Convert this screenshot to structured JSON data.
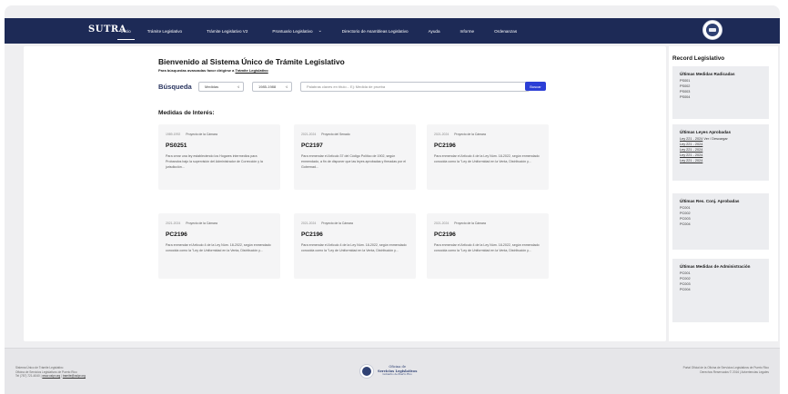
{
  "nav": {
    "logo": "SUTRA",
    "items": [
      "Inicio",
      "Trámite Legislativo",
      "Trámite Legislativo V2",
      "Prontuario Legislativo",
      "Directorio de Asambleas Legislativo",
      "Ayuda",
      "Informe",
      "Ordenanzas"
    ],
    "dropdown_glyph": "⌄"
  },
  "main": {
    "title": "Bienvenido al Sistema Único de Trámite Legislativo",
    "subtitle_prefix": "Para búsquedas avanzadas favor dirigirse a ",
    "subtitle_link": "Trámite Legislativo",
    "search": {
      "label": "Búsqueda",
      "type_value": "Medidas",
      "period_value": "1985-1988",
      "placeholder": "Palabras claves en título... Ej: Medida de prueba",
      "button": "Buscar"
    },
    "interest_title": "Medidas de Interés:",
    "cards": [
      {
        "period": "1989-1992",
        "origin": "Proyecto de la Cámara",
        "id": "PS0251",
        "desc": "Para crear una ley estableciendo los Hogares intermedios para Probandos bajo la supervisión del Administrador de Corrección y la jurisdicción..."
      },
      {
        "period": "2021-2024",
        "origin": "Proyecto del Senado",
        "id": "PC2197",
        "desc": "Para enmendar el Artículo 37 del Código Político de 1902, según enmendado, a fin de disponer que las leyes aprobadas y firmadas por el Gobernad..."
      },
      {
        "period": "2021-2024",
        "origin": "Proyecto de la Cámara",
        "id": "PC2196",
        "desc": "Para enmendar el Artículo 4 de la Ley Núm. 18-2022, según enmendado conocida como la \"Ley de Uniformidad en la Venta, Distribución y..."
      },
      {
        "period": "2021-2024",
        "origin": "Proyecto de la Cámara",
        "id": "PC2196",
        "desc": "Para enmendar el Artículo 4 de la Ley Núm. 18-2022, según enmendado conocida como la \"Ley de Uniformidad en la Venta, Distribución y..."
      },
      {
        "period": "2021-2024",
        "origin": "Proyecto de la Cámara",
        "id": "PC2196",
        "desc": "Para enmendar el Artículo 4 de la Ley Núm. 18-2022, según enmendado conocida como la \"Ley de Uniformidad en la Venta, Distribución y..."
      },
      {
        "period": "2021-2024",
        "origin": "Proyecto de la Cámara",
        "id": "PC2196",
        "desc": "Para enmendar el Artículo 4 de la Ley Núm. 18-2022, según enmendado conocida como la \"Ley de Uniformidad en la Venta, Distribución y..."
      }
    ]
  },
  "side": {
    "title": "Record Legislativo",
    "radicadas": {
      "title": "Últimas Medidas Radicadas",
      "items": [
        "PS001",
        "PS002",
        "PS003",
        "PS004"
      ]
    },
    "leyes": {
      "title": "Últimas Leyes Aprobadas",
      "first_link": "Ley 221 - 2024",
      "first_suffix": " Ver / Descargar",
      "items": [
        "Ley 221 - 2024",
        "Ley 221 - 2024",
        "Ley 221 - 2024",
        "Ley 221 - 2024"
      ]
    },
    "resconj": {
      "title": "Últimas Res. Conj. Aprobadas",
      "items": [
        "PC001",
        "PC002",
        "PC003",
        "PC004"
      ]
    },
    "admin": {
      "title": "Últimas Medidas de Administración",
      "items": [
        "PC001",
        "PC002",
        "PC003",
        "PC004"
      ]
    }
  },
  "footer": {
    "left_line1": "Sistema Único de Trámite Legislativo",
    "left_line2": "Oficina de Servicios Legislativos de Puerto Rico",
    "left_line3_prefix": "Tel (787) 721-6040 | ",
    "left_link1": "www.oslpr.org",
    "left_sep": " | ",
    "left_link2": "tramite@oslpr.org",
    "center_line1": "Oficina de",
    "center_line2": "Servicios Legislativos",
    "center_line3": "Gobierno de Puerto Rico",
    "right_line1": "Portal Oficial de la Oficina de Servicios Legislativos de Puerto Rico",
    "right_line2": "Derechos Reservados © 2016 | Advertencias Legales"
  },
  "colors": {
    "nav": "#1d2a56",
    "accent": "#2c3fd6",
    "background": "#efeff1"
  }
}
